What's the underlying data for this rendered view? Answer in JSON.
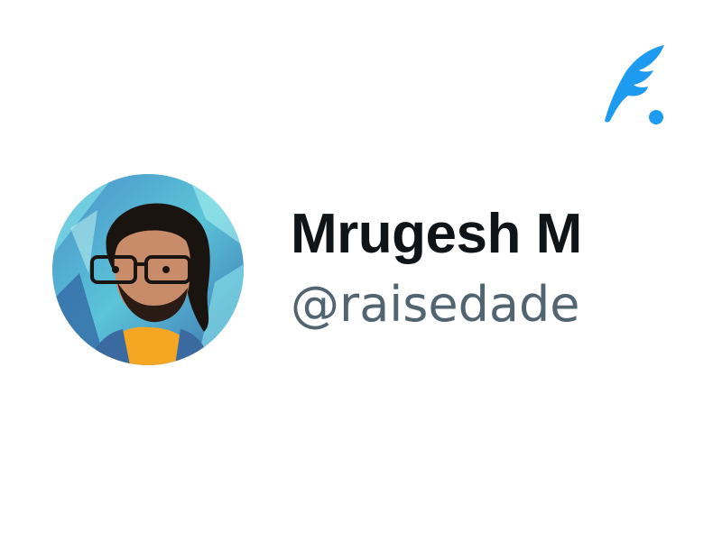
{
  "profile": {
    "display_name": "Mrugesh M",
    "handle": "@raisedade",
    "avatar_alt": "avatar"
  },
  "logo": {
    "icon": "quill-feather-icon"
  },
  "colors": {
    "brand": "#1d9bf0",
    "name_text": "#0f1419",
    "handle_text": "#536471",
    "background": "#ffffff"
  }
}
